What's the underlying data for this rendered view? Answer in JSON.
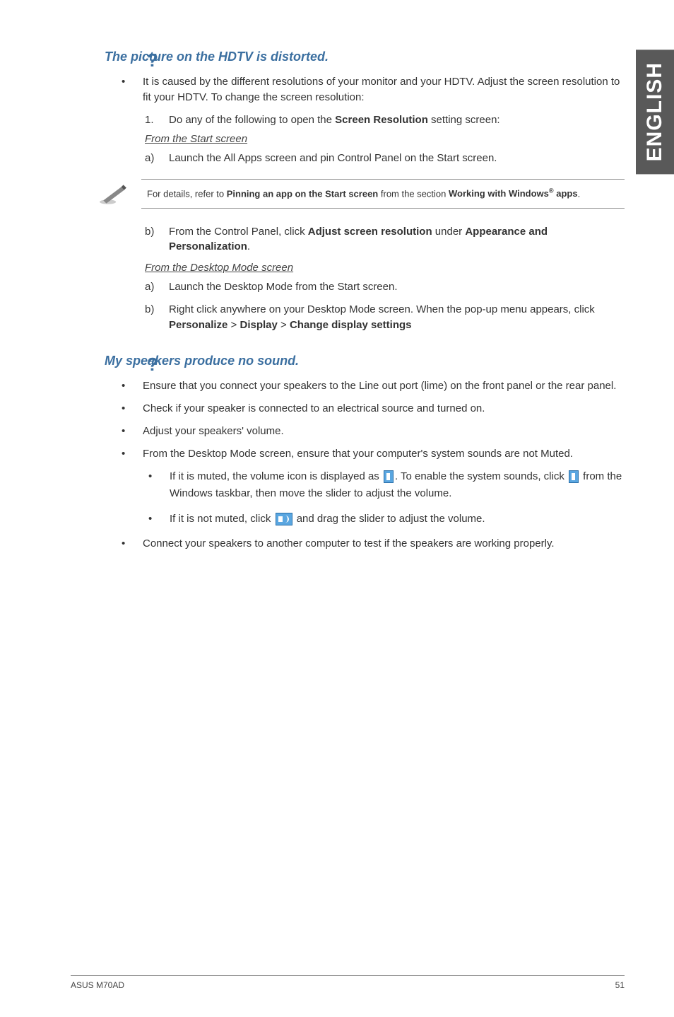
{
  "side_tab": "ENGLISH",
  "sections": [
    {
      "qmark": "?",
      "title": "The picture on the HDTV is distorted.",
      "bullets": [
        {
          "text_parts": [
            "It is caused by the different resolutions of your monitor and your HDTV. Adjust the screen resolution to fit your HDTV. To change the screen resolution:"
          ]
        }
      ],
      "numbered": [
        {
          "n": "1.",
          "pre": "Do any of the following to open the ",
          "bold": "Screen Resolution",
          "post": " setting screen:"
        }
      ],
      "sub1_label": "From the Start screen",
      "sub1_letters": [
        {
          "l": "a)",
          "text": "Launch the All Apps screen and pin Control Panel on the Start screen."
        }
      ],
      "note": {
        "pre": "For details, refer to ",
        "bold1": "Pinning an app on the Start screen",
        "mid": " from the section ",
        "bold2_a": "Working with Windows",
        "bold2_sup": "®",
        "bold2_b": " apps",
        "post": "."
      },
      "sub1b_letters": [
        {
          "l": "b)",
          "pre": "From the Control Panel, click ",
          "bold1": "Adjust screen resolution",
          "mid": " under ",
          "bold2": "Appearance and Personalization",
          "post": "."
        }
      ],
      "sub2_label": "From the Desktop Mode screen",
      "sub2_letters": [
        {
          "l": "a)",
          "text": "Launch the Desktop Mode from the Start screen."
        },
        {
          "l": "b)",
          "pre": "Right click anywhere on your Desktop Mode screen. When the pop-up menu appears, click ",
          "bold1": "Personalize",
          "sep1": " > ",
          "bold2": "Display",
          "sep2": " > ",
          "bold3": "Change display settings"
        }
      ]
    },
    {
      "qmark": "?",
      "title": "My speakers produce no sound.",
      "bullets2": [
        "Ensure that you connect your speakers to the Line out port (lime) on the front panel or the rear panel.",
        "Check if your speaker is connected to an electrical source and turned on.",
        "Adjust your speakers' volume.",
        "From the Desktop Mode screen, ensure that your computer's system sounds are not Muted."
      ],
      "sub_bullets": [
        {
          "pre1": "If it is muted, the volume icon is displayed as ",
          "icon1": "muted",
          "mid1": ". To enable the system sounds, click ",
          "icon2": "muted",
          "post1": " from the Windows taskbar, then move the slider to adjust the volume."
        },
        {
          "pre1": "If it is not muted, click ",
          "icon1": "vol",
          "post1": " and drag the slider to adjust the volume."
        }
      ],
      "bullets3": [
        "Connect your speakers to another computer to test if the speakers are working properly."
      ]
    }
  ],
  "footer": {
    "left": "ASUS M70AD",
    "right": "51"
  }
}
